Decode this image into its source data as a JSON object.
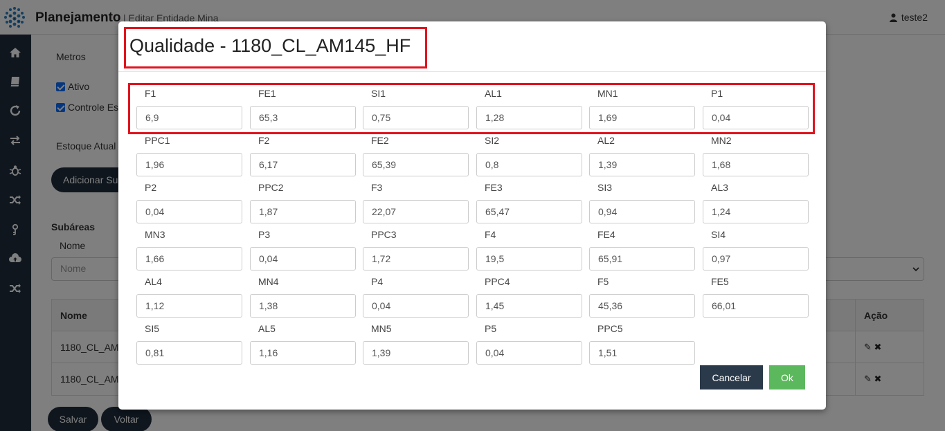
{
  "header": {
    "brand": "Planejamento",
    "breadcrumb": "| Editar Entidade Mina",
    "user": "teste2"
  },
  "sidebar": {
    "items": [
      "home-icon",
      "book-icon",
      "refresh-icon",
      "exchange-icon",
      "bug-icon",
      "shuffle-icon",
      "key-icon",
      "cloud-upload-icon",
      "shuffle-icon"
    ]
  },
  "page": {
    "metros_label": "Metros",
    "ativo_label": "Ativo",
    "controle_label": "Controle Es",
    "estoque_label": "Estoque Atual",
    "adicionar_label": "Adicionar Su",
    "subareas_label": "Subáreas",
    "nome_label": "Nome",
    "nome_placeholder": "Nome",
    "table": {
      "col_nome": "Nome",
      "col_acao": "Ação",
      "rows": [
        "1180_CL_AM",
        "1180_CL_AM"
      ]
    },
    "salvar_label": "Salvar",
    "voltar_label": "Voltar"
  },
  "modal": {
    "title": "Qualidade - 1180_CL_AM145_HF",
    "fields": [
      {
        "label": "F1",
        "value": "6,9"
      },
      {
        "label": "FE1",
        "value": "65,3"
      },
      {
        "label": "SI1",
        "value": "0,75"
      },
      {
        "label": "AL1",
        "value": "1,28"
      },
      {
        "label": "MN1",
        "value": "1,69"
      },
      {
        "label": "P1",
        "value": "0,04"
      },
      {
        "label": "PPC1",
        "value": "1,96"
      },
      {
        "label": "F2",
        "value": "6,17"
      },
      {
        "label": "FE2",
        "value": "65,39"
      },
      {
        "label": "SI2",
        "value": "0,8"
      },
      {
        "label": "AL2",
        "value": "1,39"
      },
      {
        "label": "MN2",
        "value": "1,68"
      },
      {
        "label": "P2",
        "value": "0,04"
      },
      {
        "label": "PPC2",
        "value": "1,87"
      },
      {
        "label": "F3",
        "value": "22,07"
      },
      {
        "label": "FE3",
        "value": "65,47"
      },
      {
        "label": "SI3",
        "value": "0,94"
      },
      {
        "label": "AL3",
        "value": "1,24"
      },
      {
        "label": "MN3",
        "value": "1,66"
      },
      {
        "label": "P3",
        "value": "0,04"
      },
      {
        "label": "PPC3",
        "value": "1,72"
      },
      {
        "label": "F4",
        "value": "19,5"
      },
      {
        "label": "FE4",
        "value": "65,91"
      },
      {
        "label": "SI4",
        "value": "0,97"
      },
      {
        "label": "AL4",
        "value": "1,12"
      },
      {
        "label": "MN4",
        "value": "1,38"
      },
      {
        "label": "P4",
        "value": "0,04"
      },
      {
        "label": "PPC4",
        "value": "1,45"
      },
      {
        "label": "F5",
        "value": "45,36"
      },
      {
        "label": "FE5",
        "value": "66,01"
      },
      {
        "label": "SI5",
        "value": "0,81"
      },
      {
        "label": "AL5",
        "value": "1,16"
      },
      {
        "label": "MN5",
        "value": "1,39"
      },
      {
        "label": "P5",
        "value": "0,04"
      },
      {
        "label": "PPC5",
        "value": "1,51"
      }
    ],
    "cancel_label": "Cancelar",
    "ok_label": "Ok"
  },
  "colors": {
    "sidebar": "#1f2d3d",
    "highlight": "#e0141e",
    "ok": "#5cb85c",
    "cancel": "#2b3a4a"
  }
}
